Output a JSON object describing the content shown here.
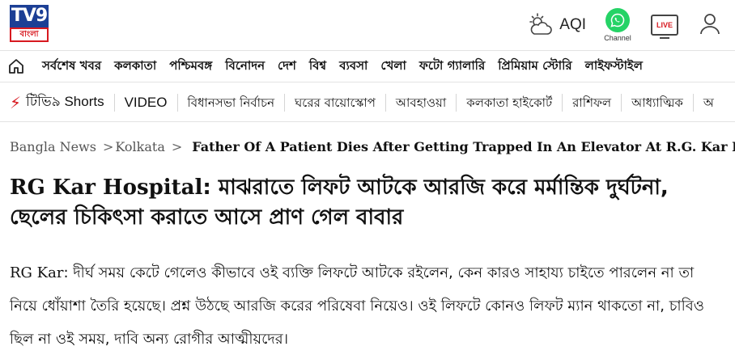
{
  "header": {
    "logo": {
      "brand": "TV9",
      "sub": "বাংলা"
    },
    "aqi_label": "AQI",
    "whatsapp_label": "Channel",
    "live_label": "LIVE"
  },
  "nav_primary": [
    "সর্বশেষ খবর",
    "কলকাতা",
    "পশ্চিমবঙ্গ",
    "বিনোদন",
    "দেশ",
    "বিশ্ব",
    "ব্যবসা",
    "খেলা",
    "ফটো গ্যালারি",
    "প্রিমিয়াম স্টোরি",
    "লাইফস্টাইল"
  ],
  "nav_secondary": {
    "shorts": "টিভি৯ Shorts",
    "items": [
      "VIDEO",
      "বিধানসভা নির্বাচন",
      "ঘরের বায়োস্কোপ",
      "আবহাওয়া",
      "কলকাতা হাইকোর্ট",
      "রাশিফল",
      "আধ্যাত্মিক",
      "অ"
    ]
  },
  "breadcrumb": {
    "home": "Bangla News",
    "section": "Kolkata",
    "current": "Father Of A Patient Dies After Getting Trapped In An Elevator At R.G. Kar Hosp"
  },
  "article": {
    "headline_prefix": "RG Kar Hospital",
    "headline_rest": ": মাঝরাতে লিফট আটকে আরজি করে মর্মান্তিক দুর্ঘটনা, ছেলের চিকিৎসা করাতে আসে প্রাণ গেল বাবার",
    "lede_prefix": "RG Kar",
    "lede_rest": ": দীর্ঘ সময় কেটে গেলেও কীভাবে ওই ব্যক্তি লিফটে আটকে রইলেন, কেন কারও সাহায্য চাইতে পারলেন না তা নিয়ে ধোঁয়াশা তৈরি হয়েছে। প্রশ্ন উঠছে আরজি করের পরিষেবা নিয়েও। ওই লিফটে কোনও লিফট ম্যান থাকতো না, চাবিও ছিল না ওই সময়, দাবি অন্য রোগীর আত্মীয়দের।"
  },
  "colors": {
    "brand_blue": "#1c3f95",
    "brand_red": "#d71920",
    "whatsapp_green": "#25d366"
  }
}
